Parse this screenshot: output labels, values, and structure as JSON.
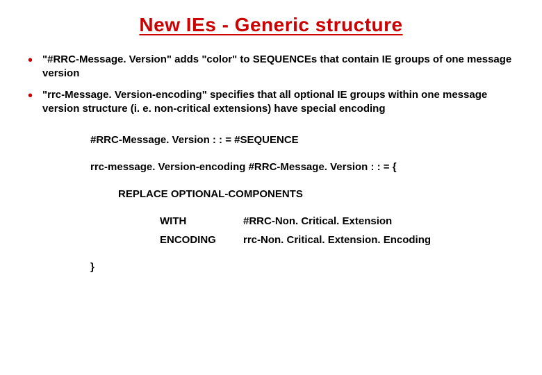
{
  "title": "New IEs - Generic structure",
  "bullets": [
    "\"#RRC-Message. Version\" adds \"color\" to SEQUENCEs that contain IE groups of one message version",
    "\"rrc-Message. Version-encoding\" specifies that all optional IE groups within one message version structure (i. e. non-critical extensions) have special encoding"
  ],
  "code": {
    "line1": "#RRC-Message. Version : : = #SEQUENCE",
    "line2": "rrc-message. Version-encoding #RRC-Message. Version : : = {",
    "line3": "REPLACE OPTIONAL-COMPONENTS",
    "line4_kw": "WITH",
    "line4_val": "#RRC-Non. Critical. Extension",
    "line5_kw": "ENCODING",
    "line5_val": "rrc-Non. Critical. Extension. Encoding",
    "line6": "}"
  }
}
